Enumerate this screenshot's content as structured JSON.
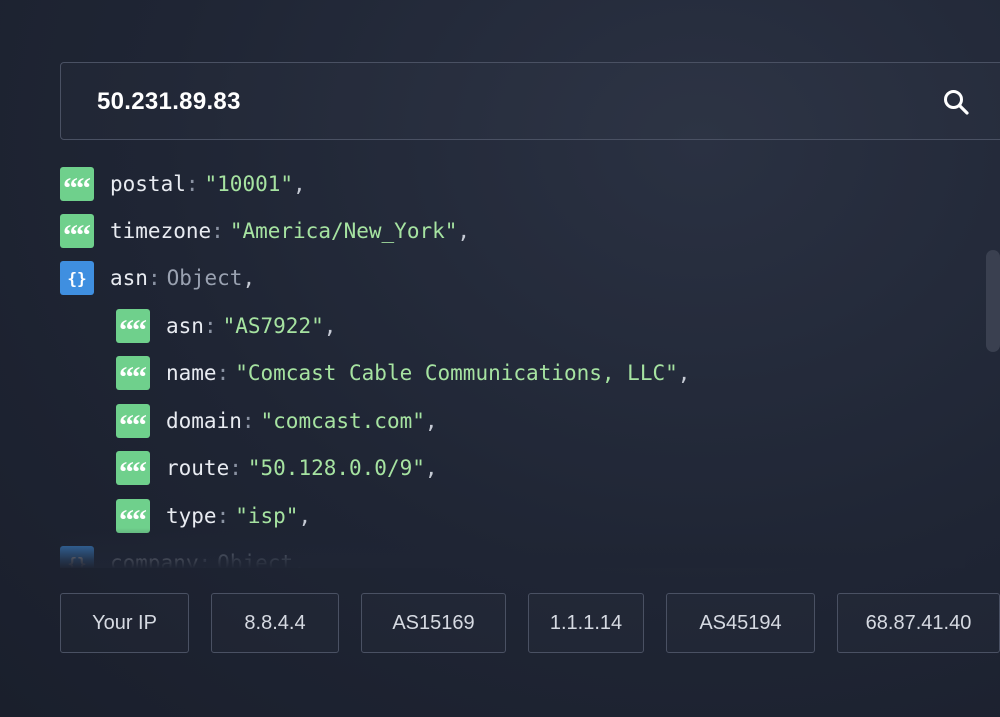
{
  "search": {
    "value": "50.231.89.83",
    "icon": "search-icon"
  },
  "json_view": {
    "rows": [
      {
        "type": "string",
        "key": "postal",
        "value": "\"10001\"",
        "suffix": ","
      },
      {
        "type": "string",
        "key": "timezone",
        "value": "\"America/New_York\"",
        "suffix": ","
      },
      {
        "type": "object",
        "key": "asn",
        "value": "Object",
        "suffix": ","
      },
      {
        "type": "string",
        "key": "asn",
        "value": "\"AS7922\"",
        "suffix": ","
      },
      {
        "type": "string",
        "key": "name",
        "value": "\"Comcast Cable Communications, LLC\"",
        "suffix": ","
      },
      {
        "type": "string",
        "key": "domain",
        "value": "\"comcast.com\"",
        "suffix": ","
      },
      {
        "type": "string",
        "key": "route",
        "value": "\"50.128.0.0/9\"",
        "suffix": ","
      },
      {
        "type": "string",
        "key": "type",
        "value": "\"isp\"",
        "suffix": ","
      },
      {
        "type": "object",
        "key": "company",
        "value": "Object",
        "suffix": ","
      }
    ],
    "colon": ":",
    "string_glyph": "“",
    "object_glyph": "{}"
  },
  "quick_links": [
    "Your IP",
    "8.8.4.4",
    "AS15169",
    "1.1.1.14",
    "AS45194",
    "68.87.41.40"
  ],
  "colors": {
    "background": "#1f2534",
    "string_badge": "#6fd08c",
    "object_badge": "#3f8fe0",
    "string_value": "#a6e3a1"
  }
}
